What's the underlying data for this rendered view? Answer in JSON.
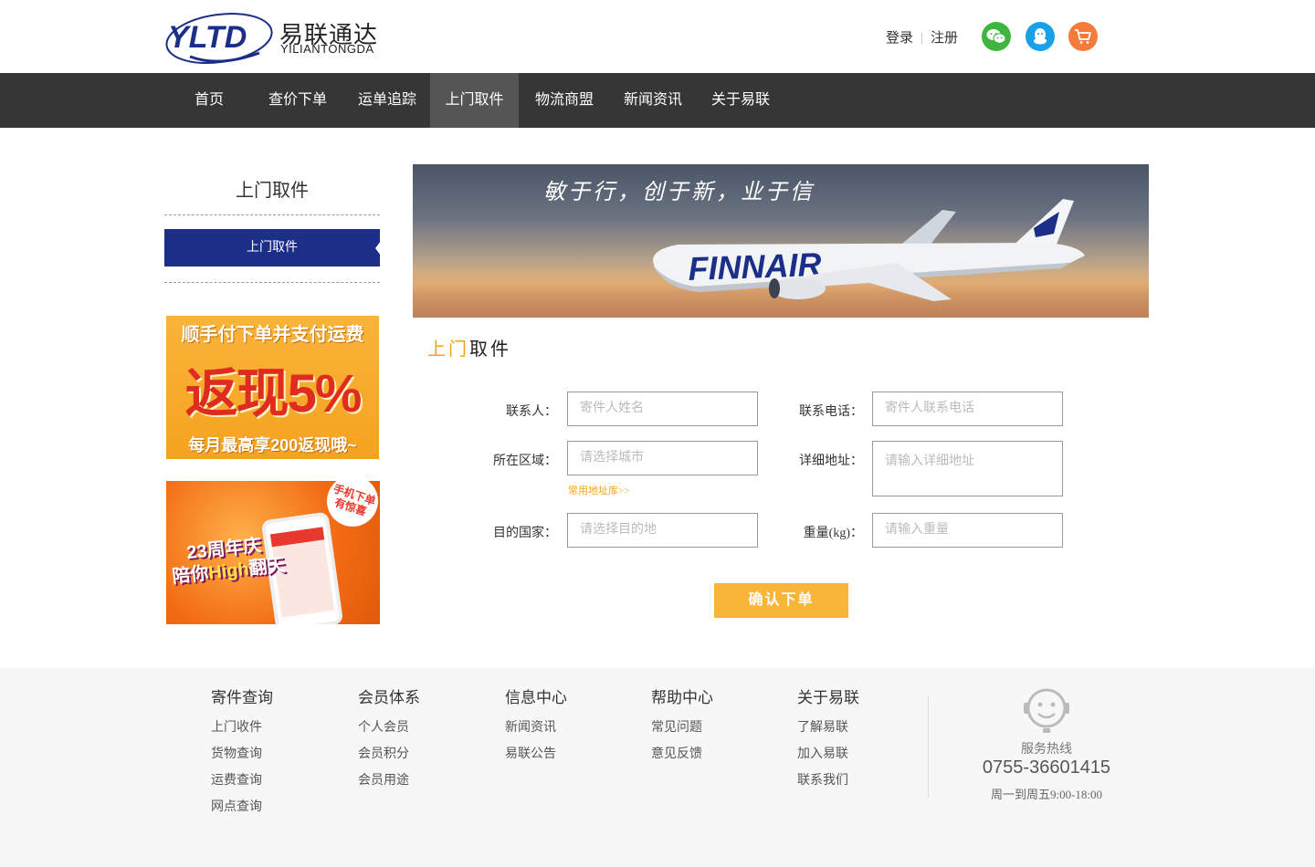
{
  "header": {
    "logo_cn": "易联通达",
    "logo_en": "YILIANTONGDA",
    "logo_mark": "YLTD",
    "login": "登录",
    "register": "注册",
    "icons": [
      "wechat-icon",
      "qq-icon",
      "cart-icon"
    ]
  },
  "nav": {
    "items": [
      {
        "label": "首页"
      },
      {
        "label": "查价下单"
      },
      {
        "label": "运单追踪"
      },
      {
        "label": "上门取件"
      },
      {
        "label": "物流商盟"
      },
      {
        "label": "新闻资讯"
      },
      {
        "label": "关于易联"
      }
    ],
    "active": "上门取件"
  },
  "sidebar": {
    "title": "上门取件",
    "active_item": "上门取件",
    "promo1": {
      "top": "顺手付下单并支付运费",
      "mid": "返现5%",
      "bottom": "每月最高享200返现哦~"
    },
    "promo2": {
      "badge": "手机下单有惊喜",
      "line1": "23周年庆",
      "line2_a": "陪你",
      "line2_b": "High",
      "line2_c": "翻天"
    }
  },
  "banner": {
    "slogan": "敏于行，创于新，业于信",
    "airline": "FINNAIR"
  },
  "section": {
    "title_a": "上门",
    "title_b": "取件"
  },
  "form": {
    "contact_label": "联系人：",
    "contact_placeholder": "寄件人姓名",
    "phone_label": "联系电话：",
    "phone_placeholder": "寄件人联系电话",
    "area_label": "所在区域：",
    "area_placeholder": "请选择城市",
    "address_label": "详细地址：",
    "address_placeholder": "请输入详细地址",
    "address_book": "常用地址库>>",
    "country_label": "目的国家：",
    "country_placeholder": "请选择目的地",
    "weight_label": "重量(kg)：",
    "weight_placeholder": "请输入重量",
    "submit": "确认下单"
  },
  "footer": {
    "columns": [
      {
        "heading": "寄件查询",
        "links": [
          "上门收件",
          "货物查询",
          "运费查询",
          "网点查询"
        ]
      },
      {
        "heading": "会员体系",
        "links": [
          "个人会员",
          "会员积分",
          "会员用途"
        ]
      },
      {
        "heading": "信息中心",
        "links": [
          "新闻资讯",
          "易联公告"
        ]
      },
      {
        "heading": "帮助中心",
        "links": [
          "常见问题",
          "意见反馈"
        ]
      },
      {
        "heading": "关于易联",
        "links": [
          "了解易联",
          "加入易联",
          "联系我们"
        ]
      }
    ],
    "hotline_label": "服务热线",
    "hotline_number": "0755-36601415",
    "hotline_hours": "周一到周五9:00-18:00"
  }
}
